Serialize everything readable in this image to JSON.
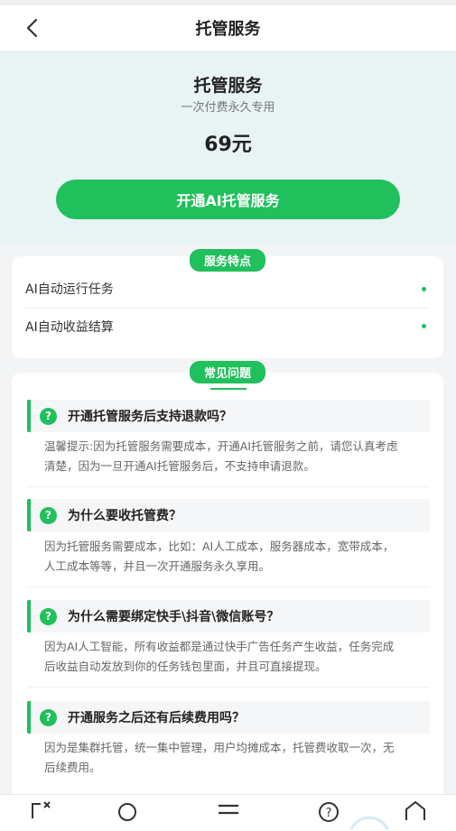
{
  "navbar": {
    "title": "托管服务"
  },
  "hero": {
    "title": "托管服务",
    "subtitle": "一次付费永久专用",
    "price": "69元",
    "button_label": "开通AI托管服务"
  },
  "features": {
    "badge": "服务特点",
    "items": [
      {
        "label": "AI自动运行任务"
      },
      {
        "label": "AI自动收益结算"
      }
    ]
  },
  "faq": {
    "badge": "常见问题",
    "items": [
      {
        "question": "开通托管服务后支持退款吗？",
        "answer_lines": [
          "温馨提示:因为托管服务需要成本，开通AI托管服务之前，请您认真考虑",
          "清楚，因为一旦开通AI托管服务后，不支持申请退款。"
        ]
      },
      {
        "question": "为什么要收托管费？",
        "answer_lines": [
          "因为托管服务需要成本，比如：AI人工成本，服务器成本，宽带成本，",
          "人工成本等等，并且一次开通服务永久享用。"
        ]
      },
      {
        "question": "为什么需要绑定快手\\抖音\\微信账号？",
        "answer_lines": [
          "因为AI人工智能，所有收益都是通过快手广告任务产生收益，任务完成",
          "后收益自动发放到你的任务钱包里面，并且可直接提现。"
        ]
      },
      {
        "question": "开通服务之后还有后续费用吗？",
        "answer_lines": [
          "因为是集群托管，统一集中管理，用户均摊成本，托管费收取一次，无",
          "后续费用。"
        ]
      }
    ]
  },
  "icons": {
    "back": "chevron-left-icon",
    "qmark": "?",
    "bottom": [
      "screenshot-icon",
      "search-icon",
      "menu-icon",
      "help-icon",
      "home-icon"
    ]
  },
  "colors": {
    "accent": "#20c05c",
    "hero_bg": "#e8f3f3"
  }
}
